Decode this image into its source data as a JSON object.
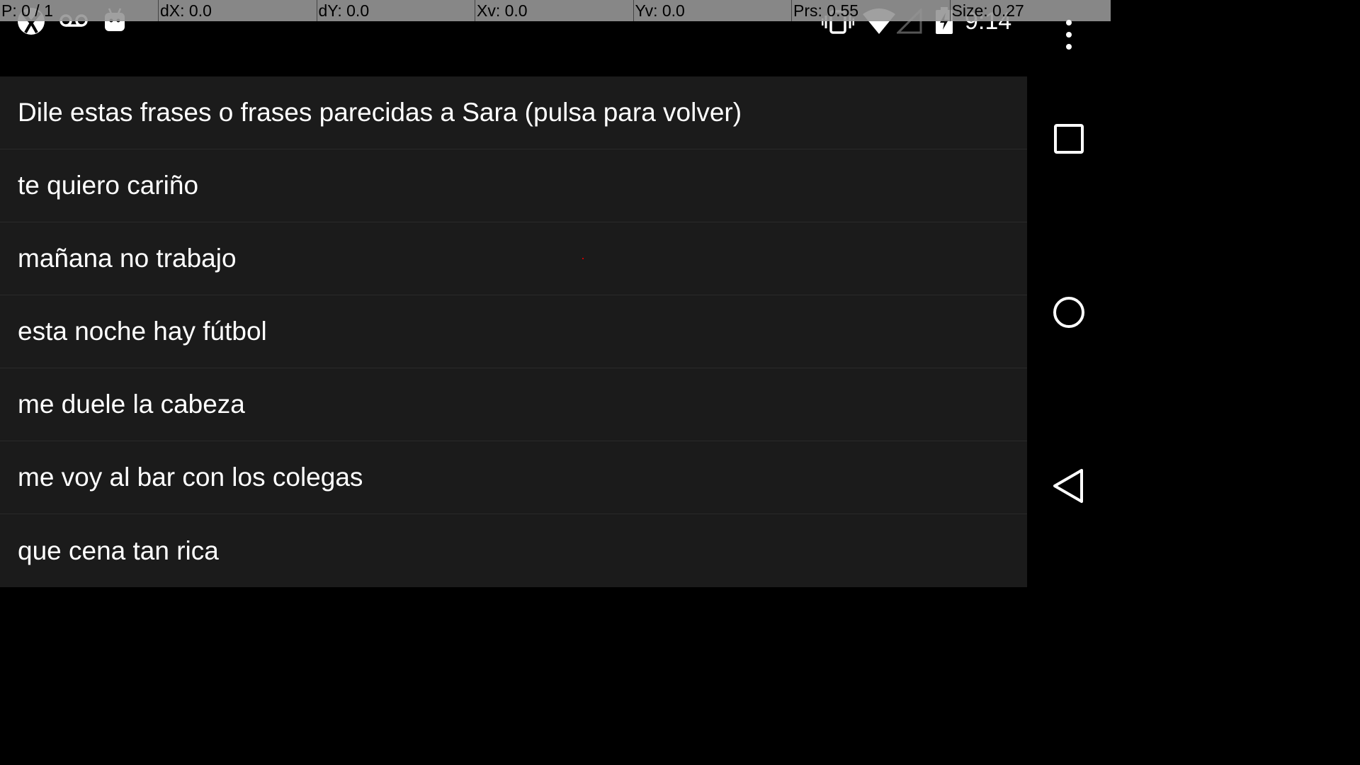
{
  "debug_overlay": {
    "pointer": "P: 0 / 1",
    "dx": "dX: 0.0",
    "dy": "dY: 0.0",
    "xv": "Xv: 0.0",
    "yv": "Yv: 0.0",
    "prs": "Prs: 0.55",
    "size": "Size: 0.27",
    "alert_color": "#ff2020"
  },
  "status_bar": {
    "icons_left": [
      "kiwi-app-icon",
      "voicemail-icon",
      "android-debug-icon"
    ],
    "icons_right": [
      "vibrate-icon",
      "wifi-icon",
      "cell-signal-icon",
      "battery-charging-icon"
    ],
    "clock": "9:14"
  },
  "list": {
    "items": [
      {
        "label": "Dile estas frases o frases parecidas a Sara (pulsa para volver)"
      },
      {
        "label": "te quiero cariño"
      },
      {
        "label": "mañana no trabajo"
      },
      {
        "label": "esta noche hay fútbol"
      },
      {
        "label": "me duele la cabeza"
      },
      {
        "label": "me voy al bar con los colegas"
      },
      {
        "label": "que cena tan rica"
      }
    ],
    "background": "#1b1b1b"
  },
  "nav_bar": {
    "buttons": [
      "recent-apps-icon",
      "home-icon",
      "back-icon"
    ]
  }
}
